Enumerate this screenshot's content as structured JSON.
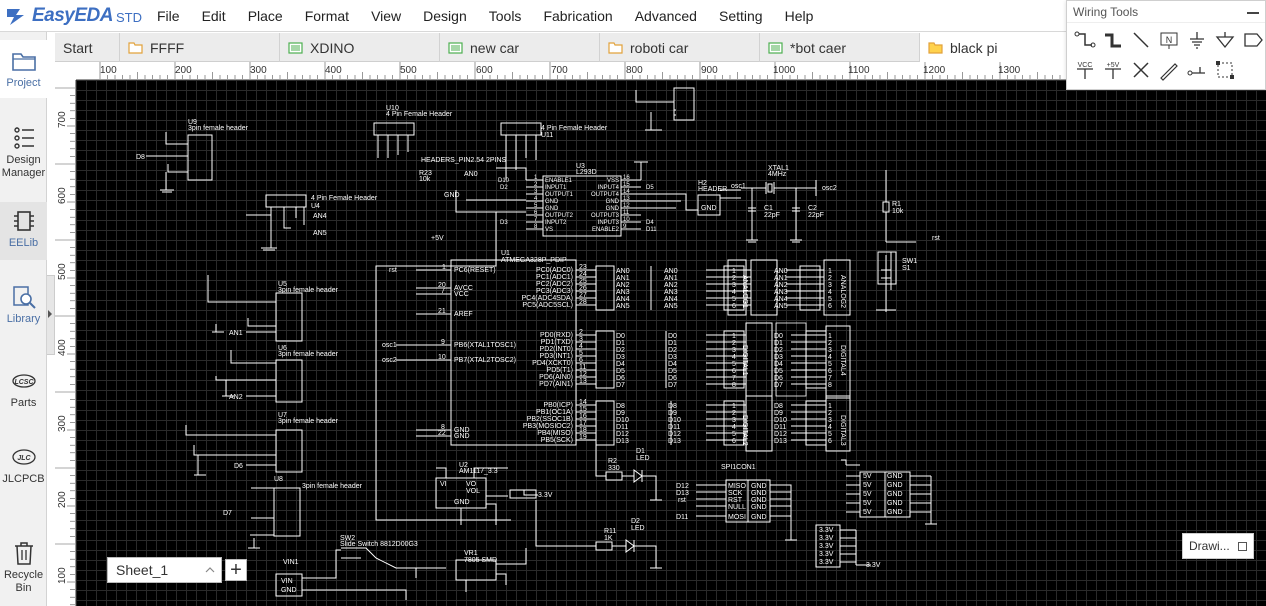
{
  "app": {
    "name": "EasyEDA",
    "edition": "STD"
  },
  "menu": [
    "File",
    "Edit",
    "Place",
    "Format",
    "View",
    "Design",
    "Tools",
    "Fabrication",
    "Advanced",
    "Setting",
    "Help"
  ],
  "wiring_tools": {
    "title": "Wiring Tools",
    "row1_icons": [
      "wire-icon",
      "bus-icon",
      "bus-entry-icon",
      "net-label-icon",
      "net-flag-gnd-icon",
      "net-flag-triangle-icon",
      "net-port-icon"
    ],
    "row2_icons": [
      "net-flag-vcc-icon",
      "net-flag-plus5v-icon",
      "no-connect-icon",
      "voltage-probe-icon",
      "pin-icon",
      "group-ungroup-icon"
    ],
    "vcc_text": "VCC",
    "plus5v_text": "+5V"
  },
  "sidebar": [
    {
      "label": "Project",
      "icon": "folder-icon"
    },
    {
      "label": "Design Manager",
      "icon": "design-manager-icon"
    },
    {
      "label": "EELib",
      "icon": "chip-icon"
    },
    {
      "label": "Library",
      "icon": "library-search-icon"
    },
    {
      "label": "Parts",
      "icon": "lcsc-icon"
    },
    {
      "label": "JLCPCB",
      "icon": "jlc-icon"
    },
    {
      "label": "Recycle Bin",
      "icon": "trash-icon"
    }
  ],
  "lcsc_text": "LCSC",
  "jlc_text": "JLC",
  "tabs": [
    {
      "label": "Start",
      "type": "start"
    },
    {
      "label": "FFFF",
      "type": "folder"
    },
    {
      "label": "XDINO",
      "type": "schematic"
    },
    {
      "label": "new car",
      "type": "schematic"
    },
    {
      "label": "roboti car",
      "type": "folder"
    },
    {
      "label": "*bot caer",
      "type": "schematic"
    },
    {
      "label": "black pi",
      "type": "folder",
      "active": true
    }
  ],
  "ruler_top": [
    "100",
    "200",
    "300",
    "400",
    "500",
    "600",
    "700",
    "800",
    "900",
    "1000",
    "1100",
    "1200",
    "1300"
  ],
  "ruler_left": [
    "700",
    "600",
    "500",
    "400",
    "300",
    "200",
    "100"
  ],
  "sheet": {
    "name": "Sheet_1",
    "add": "+"
  },
  "drawing_tools_label": "Drawi...",
  "schematic": {
    "mcu": {
      "ref": "U1",
      "name": "ATMEGA328P_PDIP",
      "left_pins": [
        {
          "num": "1",
          "name": "PC6(RESET)"
        },
        {
          "num": "20",
          "name": "AVCC"
        },
        {
          "num": "7",
          "name": "VCC"
        },
        {
          "num": "21",
          "name": "AREF"
        },
        {
          "num": "9",
          "name": "PB6(XTAL1TOSC1)"
        },
        {
          "num": "10",
          "name": "PB7(XTAL2TOSC2)"
        },
        {
          "num": "8",
          "name": "GND"
        },
        {
          "num": "22",
          "name": "GND"
        }
      ],
      "right_pins_a": [
        {
          "num": "23",
          "name": "PC0(ADC0)",
          "net": "AN0"
        },
        {
          "num": "24",
          "name": "PC1(ADC1)",
          "net": "AN1"
        },
        {
          "num": "25",
          "name": "PC2(ADC2)",
          "net": "AN2"
        },
        {
          "num": "26",
          "name": "PC3(ADC3)",
          "net": "AN3"
        },
        {
          "num": "27",
          "name": "PC4(ADC4SDA)",
          "net": "AN4"
        },
        {
          "num": "28",
          "name": "PC5(ADC5SCL)",
          "net": "AN5"
        }
      ],
      "right_pins_d": [
        {
          "num": "2",
          "name": "PD0(RXD)",
          "net": "D0"
        },
        {
          "num": "3",
          "name": "PD1(TXD)",
          "net": "D1"
        },
        {
          "num": "4",
          "name": "PD2(INT0)",
          "net": "D2"
        },
        {
          "num": "5",
          "name": "PD3(INT1)",
          "net": "D3"
        },
        {
          "num": "6",
          "name": "PD4(XCKT0)",
          "net": "D4"
        },
        {
          "num": "11",
          "name": "PD5(T1)",
          "net": "D5"
        },
        {
          "num": "12",
          "name": "PD6(AIN0)",
          "net": "D6"
        },
        {
          "num": "13",
          "name": "PD7(AIN1)",
          "net": "D7"
        }
      ],
      "right_pins_b": [
        {
          "num": "14",
          "name": "PB0(ICP)",
          "net": "D8"
        },
        {
          "num": "15",
          "name": "PB1(OC1A)",
          "net": "D9"
        },
        {
          "num": "16",
          "name": "PB2(SSOC1B)",
          "net": "D10"
        },
        {
          "num": "17",
          "name": "PB3(MOSIOC2)",
          "net": "D11"
        },
        {
          "num": "18",
          "name": "PB4(MISO)",
          "net": "D12"
        },
        {
          "num": "19",
          "name": "PB5(SCK)",
          "net": "D13"
        }
      ],
      "rst": "rst",
      "osc1": "osc1",
      "osc2": "osc2",
      "plus5v": "+5V"
    },
    "headers_3pin": [
      {
        "ref": "U9",
        "desc": "3pin female header",
        "net": "D8"
      },
      {
        "ref": "U5",
        "desc": "3pin female header",
        "net": "AN1"
      },
      {
        "ref": "U6",
        "desc": "3pin female header",
        "net": "AN2"
      },
      {
        "ref": "U7",
        "desc": "3pin female header",
        "net": "D6"
      },
      {
        "ref": "U8",
        "desc": "3pin female header",
        "net": "D7"
      }
    ],
    "u4": {
      "ref": "U4",
      "desc": "4 Pin Female Header",
      "nets": [
        "AN4",
        "AN5"
      ]
    },
    "u10": {
      "ref": "U10",
      "desc": "4 Pin Female Header"
    },
    "u11": {
      "ref": "U11",
      "desc": "4 Pin Female Header"
    },
    "u3": {
      "ref": "U3",
      "name": "L293D",
      "left": [
        "ENABLE1",
        "INPUT1",
        "OUTPUT1",
        "GND",
        "GND",
        "OUTPUT2",
        "INPUT2",
        "VS"
      ],
      "left_nums": [
        "1",
        "2",
        "3",
        "4",
        "5",
        "6",
        "7",
        "8"
      ],
      "right": [
        "VSS",
        "INPUT4",
        "OUTPUT4",
        "GND",
        "GND",
        "OUTPUT3",
        "INPUT3",
        "ENABLE2"
      ],
      "right_nums": [
        "16",
        "15",
        "14",
        "13",
        "12",
        "11",
        "10",
        "9"
      ],
      "nets_left": [
        "D10",
        "D2",
        "D3"
      ],
      "nets_right": [
        "D5",
        "D4",
        "D11"
      ]
    },
    "headers_pins": "HEADERS_PIN2.54 2PINS",
    "r23": {
      "ref": "R23",
      "val": "10k",
      "net": "AN0"
    },
    "gnd": "GND",
    "h2": {
      "ref": "H2",
      "desc": "HEADER",
      "gnd": "GND"
    },
    "xtal": {
      "ref": "XTAL1",
      "val": "4MHz",
      "left": "osc1",
      "right": "osc2"
    },
    "c1": {
      "ref": "C1",
      "val": "22pF"
    },
    "c2": {
      "ref": "C2",
      "val": "22pF"
    },
    "r1": {
      "ref": "R1",
      "val": "10k",
      "net": "rst"
    },
    "sw1": {
      "ref": "SW1",
      "alt": "S1"
    },
    "analog1": {
      "label": "ANALOG1",
      "nets": [
        "AN0",
        "AN1",
        "AN2",
        "AN3",
        "AN4",
        "AN5"
      ]
    },
    "analog2": {
      "label": "ANALOG2",
      "nets": [
        "AN0",
        "AN1",
        "AN2",
        "AN3",
        "AN4",
        "AN5"
      ]
    },
    "digital1": {
      "label": "DIGITAL1",
      "nets": [
        "D0",
        "D1",
        "D2",
        "D3",
        "D4",
        "D5",
        "D6",
        "D7"
      ]
    },
    "digital4": {
      "label": "DIGITAL4",
      "nets": [
        "D0",
        "D1",
        "D2",
        "D3",
        "D4",
        "D5",
        "D6",
        "D7"
      ]
    },
    "digital2": {
      "label": "DIGITAL2",
      "nets": [
        "D8",
        "D9",
        "D10",
        "D11",
        "D12",
        "D13"
      ]
    },
    "digital3": {
      "label": "DIGITAL3",
      "nets": [
        "D8",
        "D9",
        "D10",
        "D11",
        "D12",
        "D13"
      ]
    },
    "r2": {
      "ref": "R2",
      "val": "330"
    },
    "d1": {
      "ref": "D1",
      "val": "LED"
    },
    "r11": {
      "ref": "R11",
      "val": "1K"
    },
    "d2": {
      "ref": "D2",
      "val": "LED"
    },
    "u2": {
      "ref": "U2",
      "name": "AM1117_3.3",
      "vi": "VI",
      "vo": "VO",
      "vo2": "VOL",
      "gnd": "GND",
      "out": "3.3V"
    },
    "spi": {
      "ref": "SPI1CON1",
      "left_nets": [
        "D12",
        "D13",
        "rst",
        "D11"
      ],
      "labels": [
        "MISO",
        "SCK",
        "RST",
        "NULL",
        "MOSI"
      ],
      "gnd": "GND"
    },
    "sw2": {
      "ref": "SW2",
      "desc": "Slide Switch 8812D00G3"
    },
    "vin": {
      "ref": "VIN1",
      "pins": [
        "VIN",
        "GND"
      ]
    },
    "vr1": {
      "ref": "VR1",
      "desc": "7805 SMD"
    },
    "rail5v": {
      "label": "5V",
      "gnd": "GND"
    },
    "rail33": {
      "label": "3.3V"
    }
  }
}
